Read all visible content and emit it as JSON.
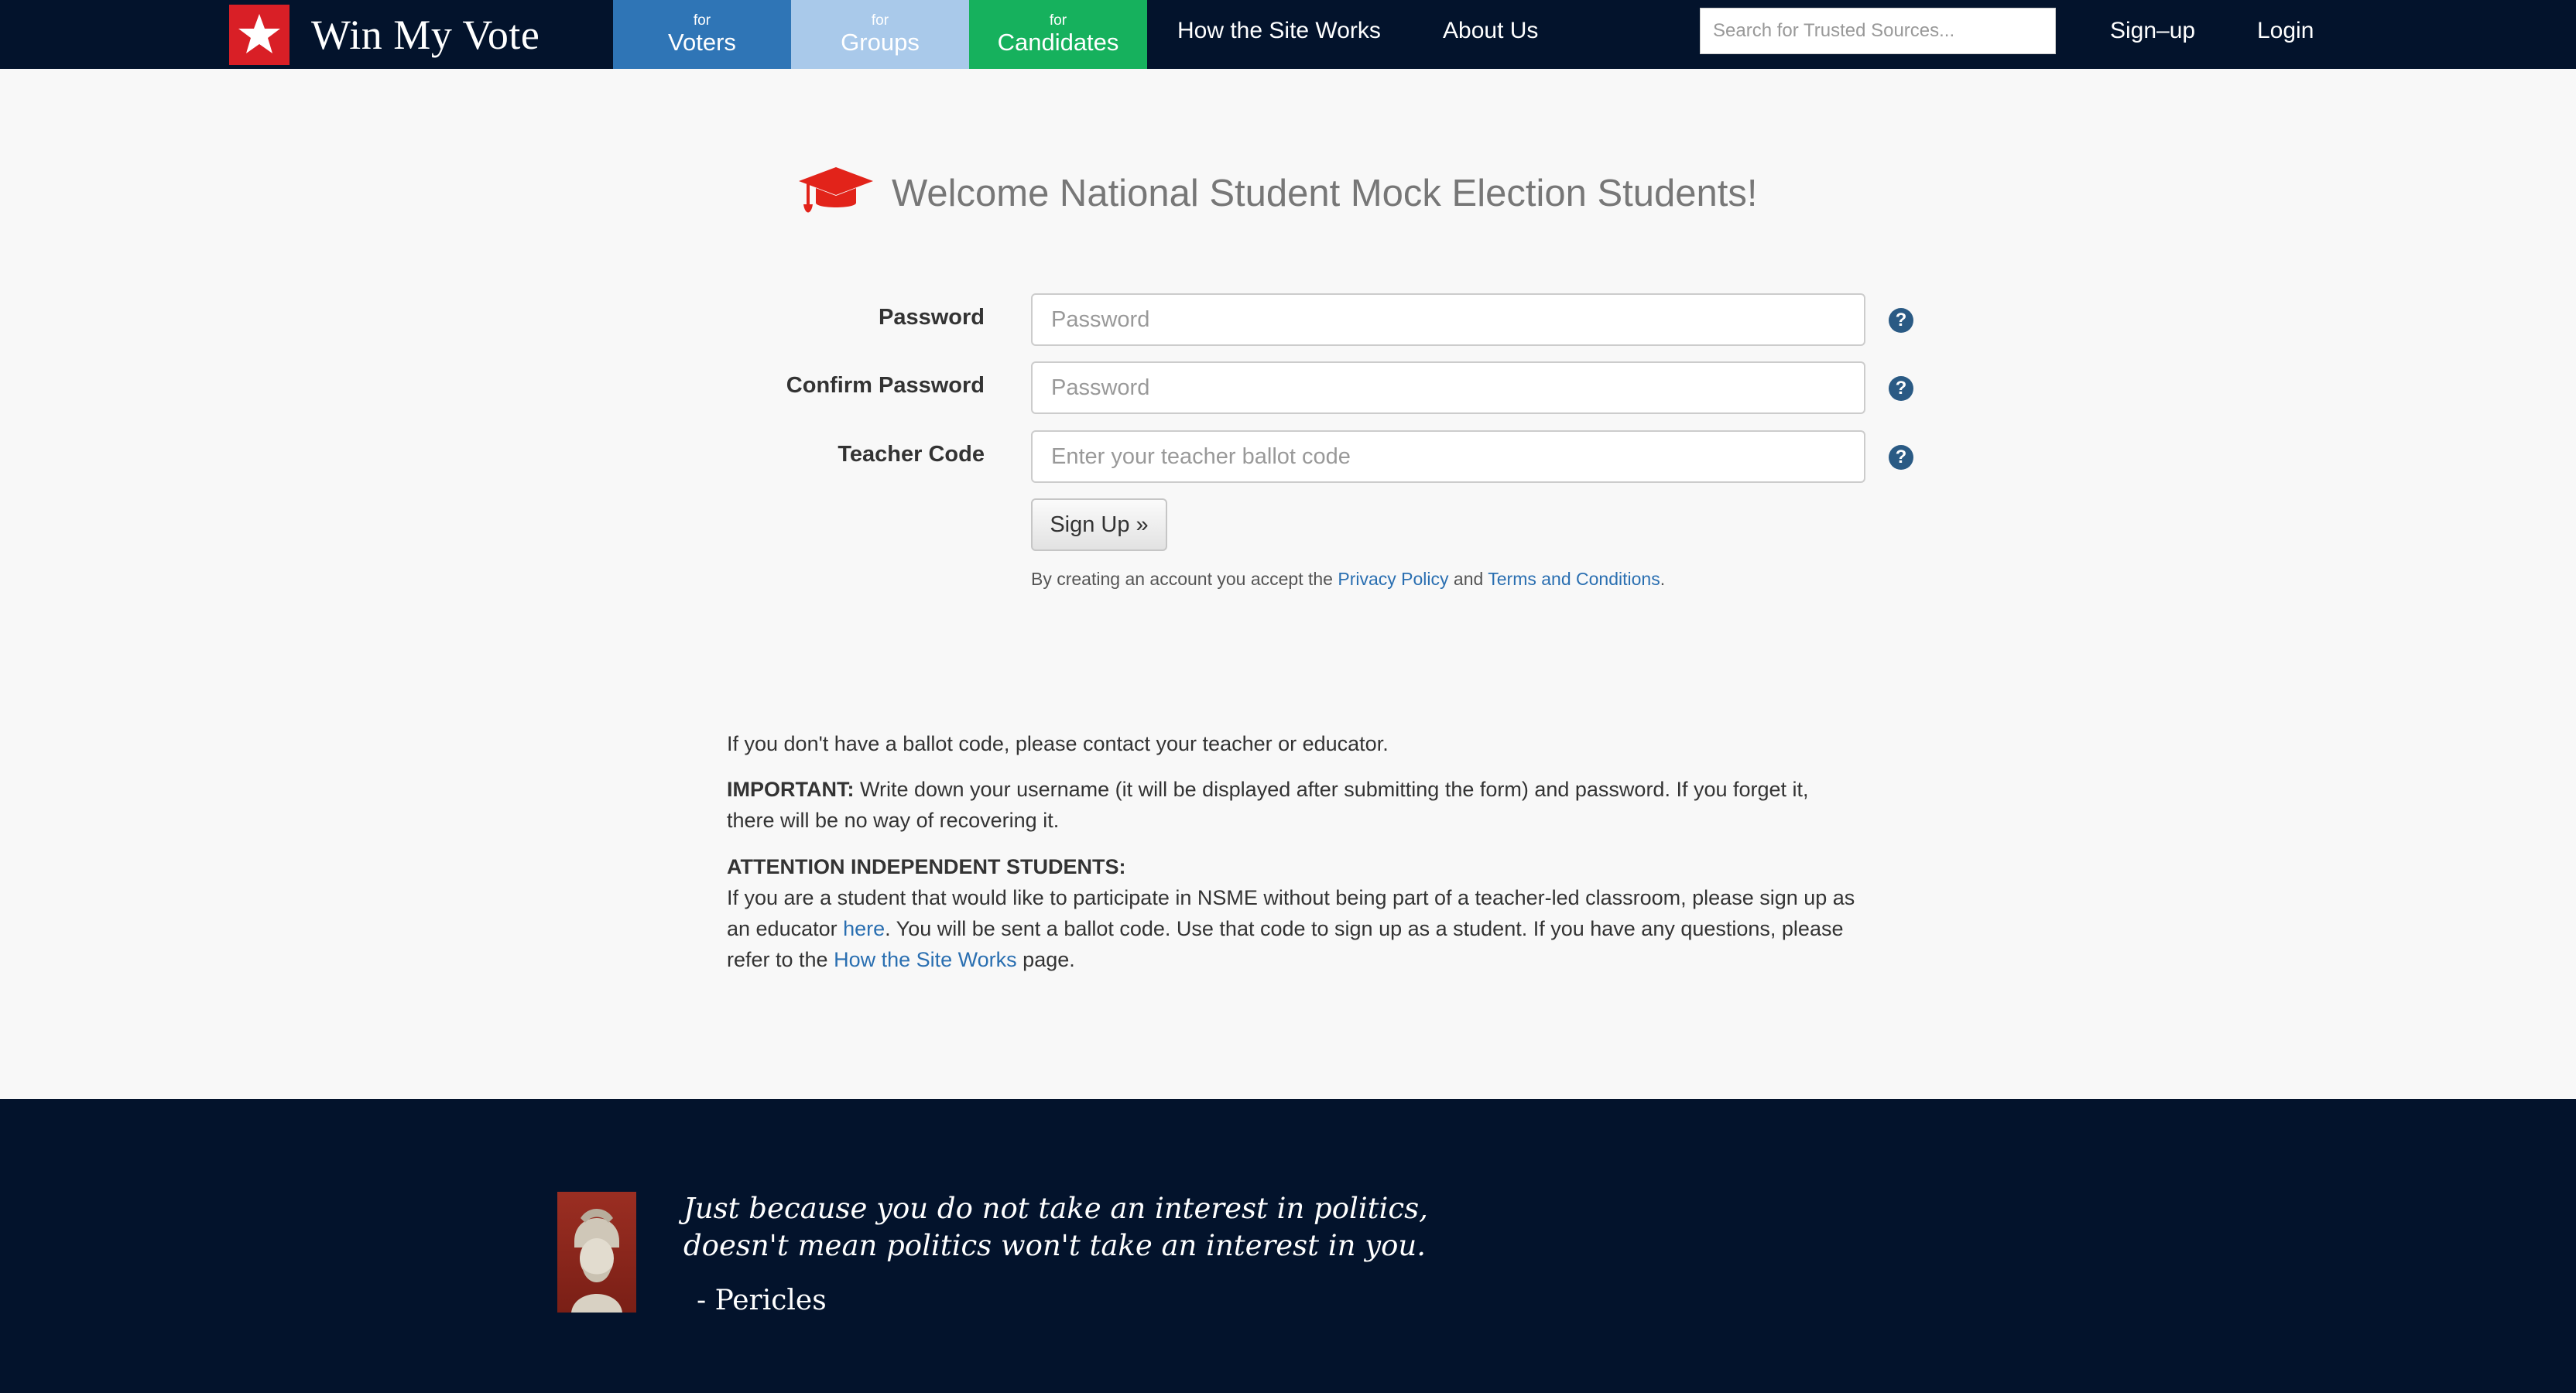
{
  "nav": {
    "brand": "Win My Vote",
    "tabs": [
      {
        "small": "for",
        "label": "Voters"
      },
      {
        "small": "for",
        "label": "Groups"
      },
      {
        "small": "for",
        "label": "Candidates"
      }
    ],
    "how_site_works": "How the Site Works",
    "about": "About Us",
    "search_placeholder": "Search for Trusted Sources...",
    "signup": "Sign–up",
    "login": "Login"
  },
  "heading": {
    "title": "Welcome National Student Mock Election Students!"
  },
  "form": {
    "password_label": "Password",
    "password_placeholder": "Password",
    "confirm_label": "Confirm Password",
    "confirm_placeholder": "Password",
    "teacher_label": "Teacher Code",
    "teacher_placeholder": "Enter your teacher ballot code",
    "help_glyph": "?",
    "submit_label": "Sign Up »",
    "terms_prefix": "By creating an account you accept the ",
    "privacy_link": "Privacy Policy",
    "terms_and": " and ",
    "terms_link": "Terms and Conditions",
    "terms_suffix": "."
  },
  "info": {
    "no_code": "If you don't have a ballot code, please contact your teacher or educator.",
    "important_label": "IMPORTANT:",
    "important_text": " Write down your username (it will be displayed after submitting the form) and password. If you forget it, there will be no way of recovering it.",
    "attention_label": "ATTENTION INDEPENDENT STUDENTS:",
    "attention_text_1": "If you are a student that would like to participate in NSME without being part of a teacher-led classroom, please sign up as an educator ",
    "here_link": "here",
    "attention_text_2": ". You will be sent a ballot code. Use that code to sign up as a student. If you have any questions, please refer to the ",
    "how_link": "How the Site Works",
    "attention_text_3": " page."
  },
  "footer": {
    "quote_line1": "Just because you do not take an interest in politics,",
    "quote_line2": "doesn't mean politics won't take an interest in you.",
    "author": "- Pericles"
  },
  "colors": {
    "nav_bg": "#03132c",
    "voters": "#2f75b6",
    "groups": "#a9c9ea",
    "candidates": "#16b15d",
    "brand_red": "#d91f26",
    "link": "#2a6fb1"
  }
}
